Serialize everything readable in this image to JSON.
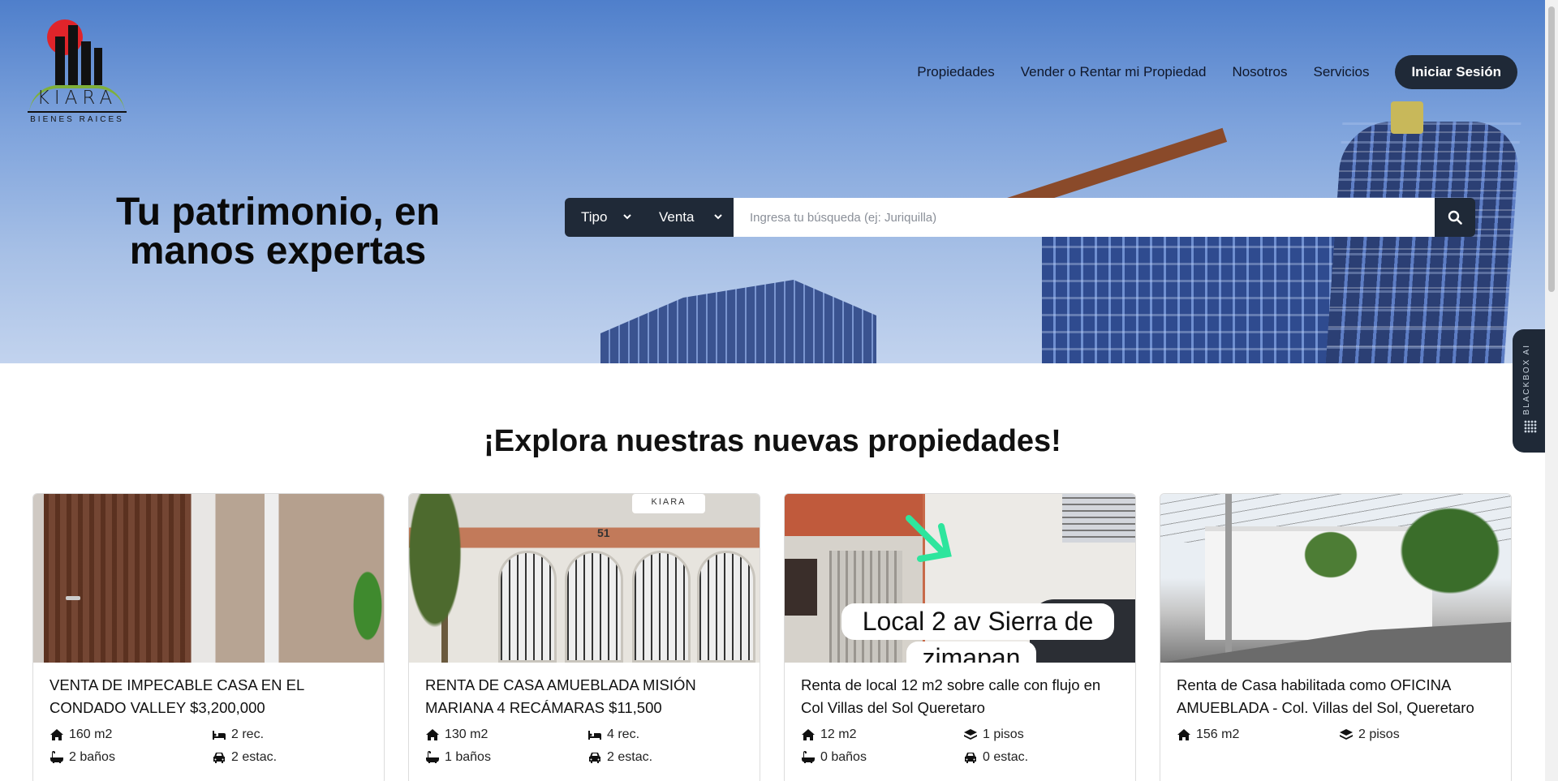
{
  "brand": {
    "name": "KIARA",
    "tagline": "BIENES RAICES"
  },
  "nav": {
    "items": [
      "Propiedades",
      "Vender o Rentar mi Propiedad",
      "Nosotros",
      "Servicios"
    ],
    "login": "Iniciar Sesión"
  },
  "hero": {
    "headline_line1": "Tu patrimonio, en",
    "headline_line2": "manos expertas"
  },
  "search": {
    "tipo_label": "Tipo",
    "operacion_label": "Venta",
    "placeholder": "Ingresa tu búsqueda (ej: Juriquilla)"
  },
  "side_widget": {
    "label": "BLACKBOX AI"
  },
  "section": {
    "title": "¡Explora nuestras nuevas propiedades!"
  },
  "cards": [
    {
      "title": "VENTA DE IMPECABLE CASA EN EL CONDADO VALLEY $3,200,000",
      "area": "160 m2",
      "second": "2 rec.",
      "second_icon": "bed-icon",
      "baths": "2 baños",
      "parking": "2 estac."
    },
    {
      "title": "RENTA DE CASA AMUEBLADA MISIÓN MARIANA 4 RECÁMARAS $11,500",
      "area": "130 m2",
      "second": "4 rec.",
      "second_icon": "bed-icon",
      "baths": "1 baños",
      "parking": "2 estac.",
      "image_sign": "KIARA",
      "image_number": "51"
    },
    {
      "title": "Renta de local 12 m2 sobre calle con flujo en Col Villas del Sol Queretaro",
      "area": "12 m2",
      "second": "1 pisos",
      "second_icon": "layers-icon",
      "baths": "0 baños",
      "parking": "0 estac.",
      "image_caption_1": "Local 2 av Sierra de",
      "image_caption_2": "zimapan"
    },
    {
      "title": "Renta de Casa habilitada como OFICINA AMUEBLADA - Col. Villas del Sol, Queretaro",
      "area": "156 m2",
      "second": "2 pisos",
      "second_icon": "layers-icon"
    }
  ]
}
